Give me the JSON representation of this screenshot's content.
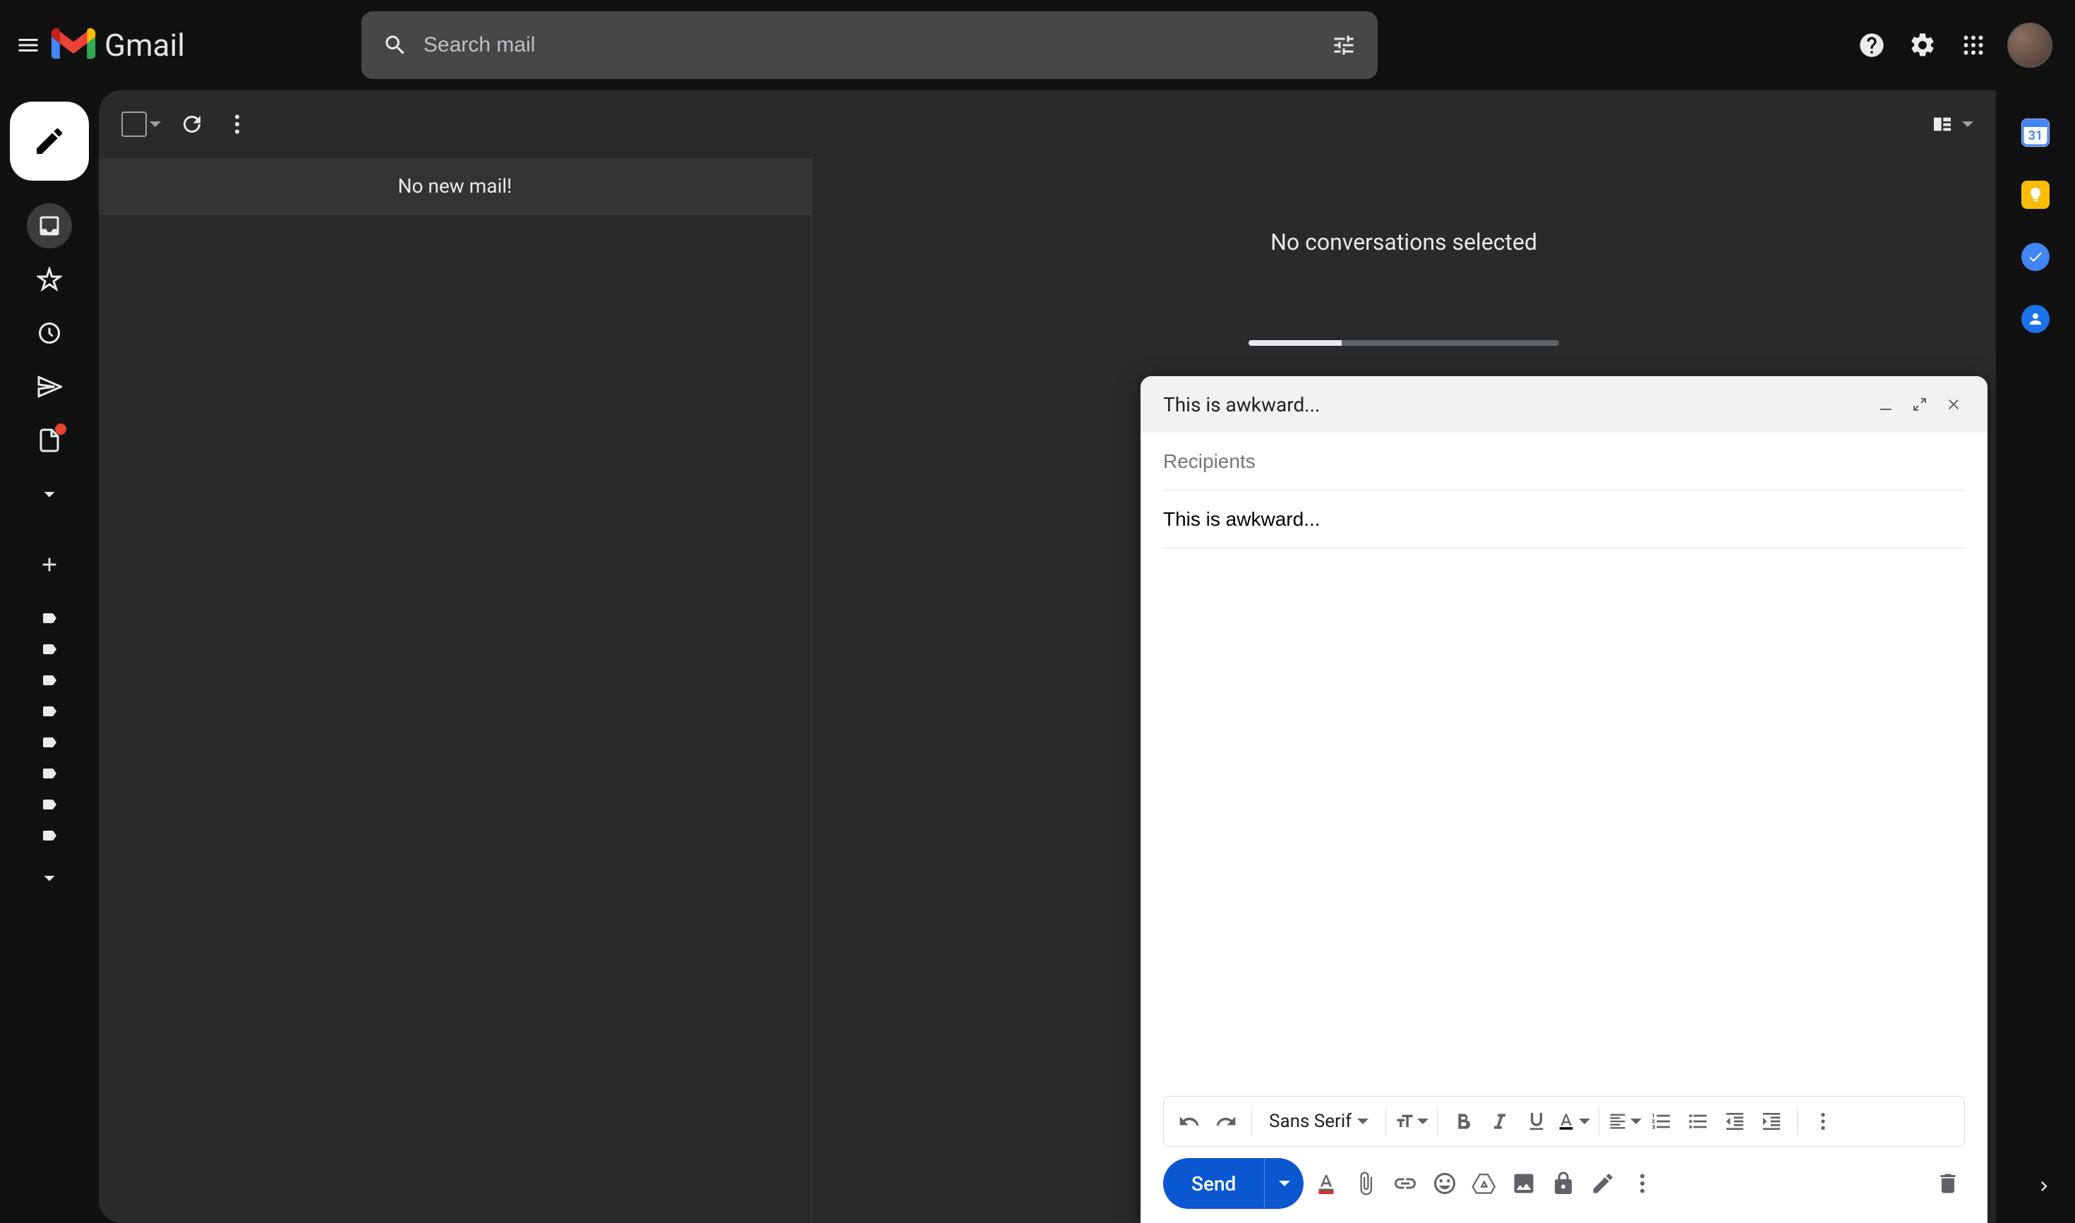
{
  "header": {
    "app_name": "Gmail",
    "search_placeholder": "Search mail"
  },
  "toolbar": {
    "view_mode": "split"
  },
  "messages": {
    "empty_text": "No new mail!",
    "pane_empty_text": "No conversations selected"
  },
  "storage": {
    "percent_used": 30
  },
  "compose": {
    "title": "This is awkward...",
    "recipients_placeholder": "Recipients",
    "subject_value": "This is awkward...",
    "font_family": "Sans Serif",
    "send_label": "Send"
  },
  "side_apps": {
    "calendar_day": "31"
  }
}
